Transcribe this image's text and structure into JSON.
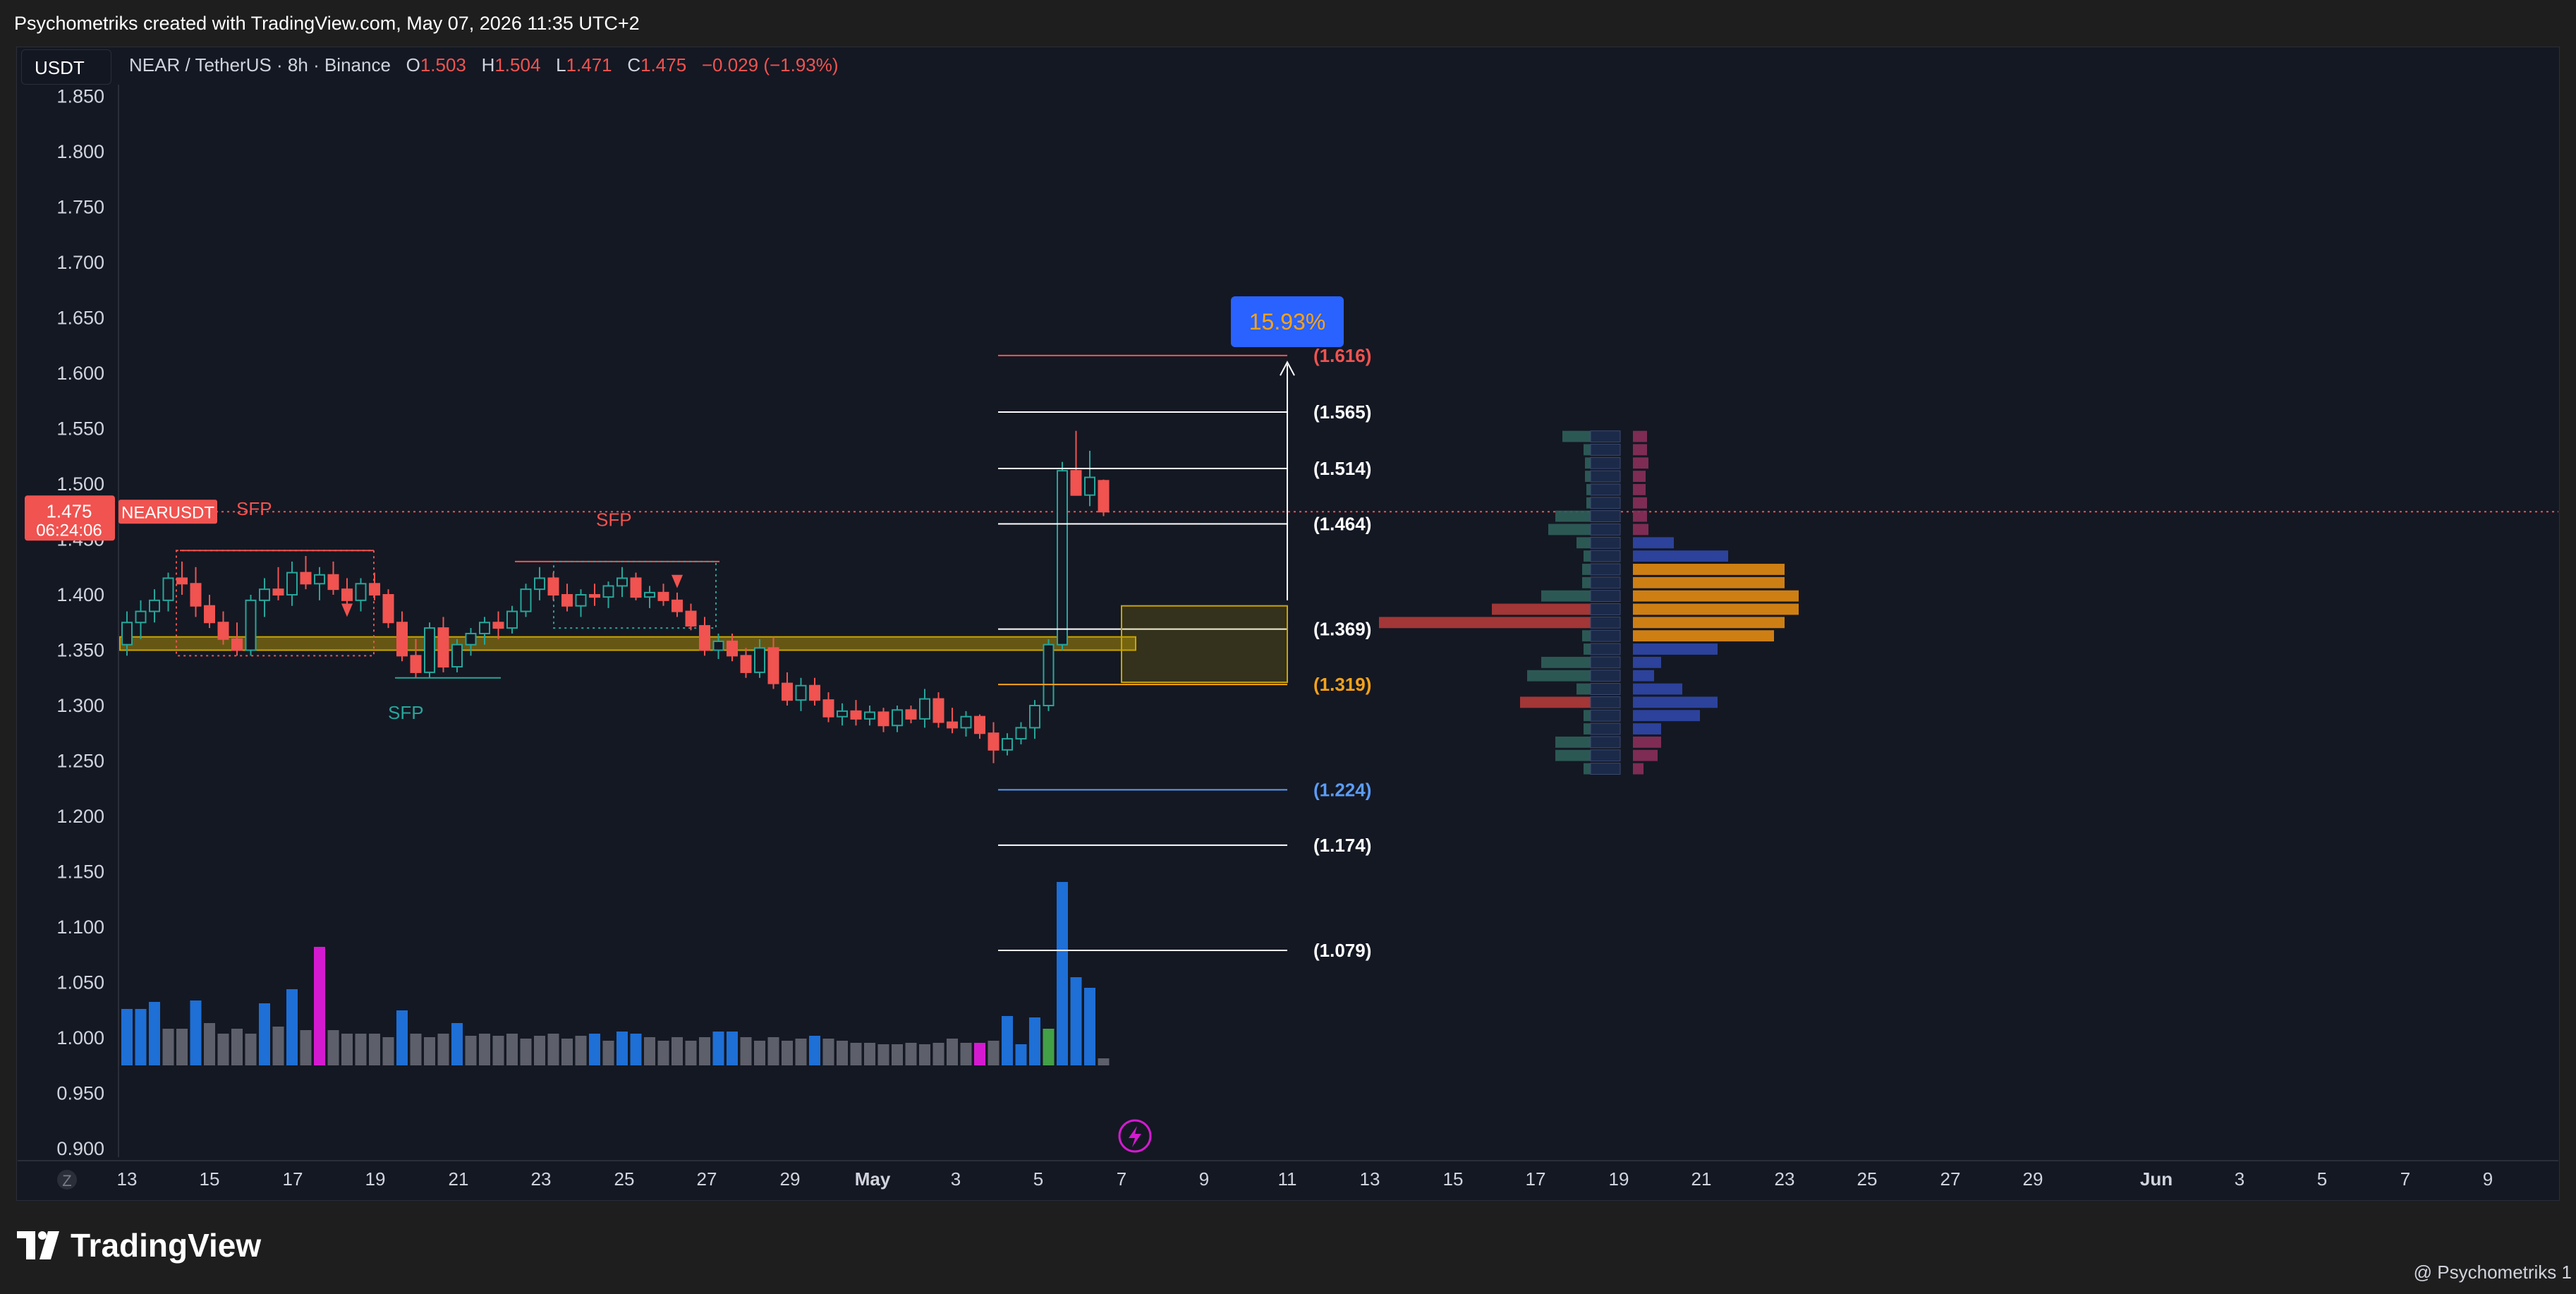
{
  "header": {
    "title": "Psychometriks created with TradingView.com, May 07, 2026 11:35 UTC+2"
  },
  "currency_button": {
    "label": "USDT"
  },
  "symbol_info": {
    "name": "NEAR / TetherUS · 8h · Binance",
    "o_label": "O",
    "o_value": "1.503",
    "h_label": "H",
    "h_value": "1.504",
    "l_label": "L",
    "l_value": "1.471",
    "c_label": "C",
    "c_value": "1.475",
    "change": "−0.029 (−1.93%)"
  },
  "price_label": {
    "value": "1.475",
    "countdown": "06:24:06",
    "symbol": "NEARUSDT"
  },
  "zoom_button": {
    "label": "Z"
  },
  "target_badge": {
    "label": "15.93%"
  },
  "branding": {
    "logo_text": "TradingView",
    "credit": "@ Psychometriks 1"
  },
  "colors": {
    "up": "#26a69a",
    "down": "#f05350",
    "accent": "#2962ff",
    "fib_orange": "#f7a21b",
    "fib_blue": "#5b9cf6",
    "volume_blue": "#1e6fd6",
    "volume_gray": "#5d606b",
    "volume_magenta": "#d41ad0",
    "volume_green": "#43a047",
    "zone": "#c8a400",
    "volume_profile_orange": "#e28b13"
  },
  "chart_data": {
    "type": "candlestick",
    "y_axis": {
      "ticks": [
        "1.850",
        "1.800",
        "1.750",
        "1.700",
        "1.650",
        "1.600",
        "1.550",
        "1.500",
        "1.450",
        "1.400",
        "1.350",
        "1.300",
        "1.250",
        "1.200",
        "1.150",
        "1.100",
        "1.050",
        "1.000",
        "0.950",
        "0.900"
      ]
    },
    "x_axis": {
      "ticks": [
        "13",
        "15",
        "17",
        "19",
        "21",
        "23",
        "25",
        "27",
        "29",
        "May",
        "3",
        "5",
        "7",
        "9",
        "11",
        "13",
        "15",
        "17",
        "19",
        "21",
        "23",
        "25",
        "27",
        "29",
        "Jun",
        "3",
        "5",
        "7",
        "9"
      ]
    },
    "fib_levels": [
      {
        "label": "(1.616)",
        "value": 1.616,
        "color": "down"
      },
      {
        "label": "(1.565)",
        "value": 1.565,
        "color": "white"
      },
      {
        "label": "(1.514)",
        "value": 1.514,
        "color": "white"
      },
      {
        "label": "(1.464)",
        "value": 1.464,
        "color": "white"
      },
      {
        "label": "(1.369)",
        "value": 1.369,
        "color": "white"
      },
      {
        "label": "(1.319)",
        "value": 1.319,
        "color": "fib_orange"
      },
      {
        "label": "(1.224)",
        "value": 1.224,
        "color": "fib_blue"
      },
      {
        "label": "(1.174)",
        "value": 1.174,
        "color": "white"
      },
      {
        "label": "(1.079)",
        "value": 1.079,
        "color": "white"
      }
    ],
    "annotations": [
      {
        "text": "SFP",
        "color": "down"
      },
      {
        "text": "SFP",
        "color": "down"
      },
      {
        "text": "SFP",
        "color": "up"
      }
    ],
    "candles": [
      [
        1.355,
        1.385,
        1.345,
        1.375
      ],
      [
        1.375,
        1.395,
        1.36,
        1.385
      ],
      [
        1.385,
        1.405,
        1.375,
        1.395
      ],
      [
        1.395,
        1.42,
        1.385,
        1.415
      ],
      [
        1.415,
        1.43,
        1.4,
        1.41
      ],
      [
        1.41,
        1.425,
        1.38,
        1.39
      ],
      [
        1.39,
        1.4,
        1.37,
        1.375
      ],
      [
        1.375,
        1.385,
        1.355,
        1.36
      ],
      [
        1.36,
        1.375,
        1.345,
        1.35
      ],
      [
        1.35,
        1.4,
        1.345,
        1.395
      ],
      [
        1.395,
        1.415,
        1.38,
        1.405
      ],
      [
        1.405,
        1.425,
        1.395,
        1.4
      ],
      [
        1.4,
        1.43,
        1.39,
        1.42
      ],
      [
        1.42,
        1.435,
        1.405,
        1.41
      ],
      [
        1.41,
        1.425,
        1.395,
        1.418
      ],
      [
        1.418,
        1.43,
        1.4,
        1.405
      ],
      [
        1.405,
        1.415,
        1.39,
        1.395
      ],
      [
        1.395,
        1.415,
        1.385,
        1.41
      ],
      [
        1.41,
        1.42,
        1.395,
        1.4
      ],
      [
        1.4,
        1.405,
        1.37,
        1.375
      ],
      [
        1.375,
        1.385,
        1.34,
        1.345
      ],
      [
        1.345,
        1.36,
        1.325,
        1.33
      ],
      [
        1.33,
        1.375,
        1.325,
        1.37
      ],
      [
        1.37,
        1.38,
        1.33,
        1.335
      ],
      [
        1.335,
        1.36,
        1.33,
        1.355
      ],
      [
        1.355,
        1.37,
        1.345,
        1.365
      ],
      [
        1.365,
        1.38,
        1.355,
        1.375
      ],
      [
        1.375,
        1.385,
        1.36,
        1.37
      ],
      [
        1.37,
        1.39,
        1.365,
        1.385
      ],
      [
        1.385,
        1.41,
        1.38,
        1.405
      ],
      [
        1.405,
        1.425,
        1.395,
        1.415
      ],
      [
        1.415,
        1.42,
        1.395,
        1.4
      ],
      [
        1.4,
        1.41,
        1.385,
        1.39
      ],
      [
        1.39,
        1.405,
        1.38,
        1.4
      ],
      [
        1.4,
        1.41,
        1.39,
        1.398
      ],
      [
        1.398,
        1.412,
        1.388,
        1.408
      ],
      [
        1.408,
        1.425,
        1.398,
        1.415
      ],
      [
        1.415,
        1.42,
        1.395,
        1.398
      ],
      [
        1.398,
        1.408,
        1.388,
        1.402
      ],
      [
        1.402,
        1.41,
        1.39,
        1.395
      ],
      [
        1.395,
        1.402,
        1.38,
        1.385
      ],
      [
        1.385,
        1.392,
        1.368,
        1.372
      ],
      [
        1.372,
        1.38,
        1.345,
        1.35
      ],
      [
        1.35,
        1.365,
        1.342,
        1.358
      ],
      [
        1.358,
        1.365,
        1.34,
        1.345
      ],
      [
        1.345,
        1.352,
        1.325,
        1.33
      ],
      [
        1.33,
        1.36,
        1.325,
        1.352
      ],
      [
        1.352,
        1.362,
        1.315,
        1.32
      ],
      [
        1.32,
        1.33,
        1.3,
        1.305
      ],
      [
        1.305,
        1.325,
        1.295,
        1.318
      ],
      [
        1.318,
        1.325,
        1.3,
        1.305
      ],
      [
        1.305,
        1.312,
        1.285,
        1.29
      ],
      [
        1.29,
        1.302,
        1.282,
        1.295
      ],
      [
        1.295,
        1.305,
        1.282,
        1.288
      ],
      [
        1.288,
        1.3,
        1.282,
        1.294
      ],
      [
        1.294,
        1.298,
        1.276,
        1.282
      ],
      [
        1.282,
        1.3,
        1.276,
        1.296
      ],
      [
        1.296,
        1.3,
        1.284,
        1.288
      ],
      [
        1.288,
        1.315,
        1.28,
        1.306
      ],
      [
        1.306,
        1.312,
        1.28,
        1.285
      ],
      [
        1.285,
        1.298,
        1.275,
        1.28
      ],
      [
        1.28,
        1.295,
        1.272,
        1.29
      ],
      [
        1.29,
        1.292,
        1.27,
        1.275
      ],
      [
        1.275,
        1.285,
        1.248,
        1.26
      ],
      [
        1.26,
        1.275,
        1.255,
        1.27
      ],
      [
        1.27,
        1.285,
        1.265,
        1.28
      ],
      [
        1.28,
        1.305,
        1.27,
        1.3
      ],
      [
        1.3,
        1.36,
        1.295,
        1.355
      ],
      [
        1.355,
        1.52,
        1.35,
        1.512
      ],
      [
        1.512,
        1.548,
        1.495,
        1.49
      ],
      [
        1.49,
        1.53,
        1.48,
        1.506
      ],
      [
        1.503,
        1.504,
        1.471,
        1.475
      ]
    ],
    "volume": [
      {
        "v": 1.0,
        "c": "volume_blue"
      },
      {
        "v": 1.0,
        "c": "volume_blue"
      },
      {
        "v": 1.0,
        "c": "volume_blue"
      },
      {
        "v": 1.0,
        "c": "volume_gray"
      },
      {
        "v": 1.0,
        "c": "volume_gray"
      },
      {
        "v": 1.0,
        "c": "volume_blue"
      },
      {
        "v": 1.0,
        "c": "volume_gray"
      },
      {
        "v": 1.0,
        "c": "volume_gray"
      },
      {
        "v": 1.0,
        "c": "volume_gray"
      },
      {
        "v": 1.0,
        "c": "volume_gray"
      },
      {
        "v": 1.0,
        "c": "volume_blue"
      },
      {
        "v": 1.0,
        "c": "volume_gray"
      },
      {
        "v": 1.0,
        "c": "volume_blue"
      },
      {
        "v": 1.0,
        "c": "volume_gray"
      },
      {
        "v": 1.0,
        "c": "volume_magenta"
      },
      {
        "v": 1.0,
        "c": "volume_gray"
      },
      {
        "v": 1.0,
        "c": "volume_gray"
      },
      {
        "v": 1.0,
        "c": "volume_gray"
      },
      {
        "v": 1.0,
        "c": "volume_gray"
      },
      {
        "v": 1.0,
        "c": "volume_gray"
      },
      {
        "v": 1.0,
        "c": "volume_blue"
      },
      {
        "v": 1.0,
        "c": "volume_gray"
      },
      {
        "v": 1.0,
        "c": "volume_gray"
      },
      {
        "v": 1.0,
        "c": "volume_gray"
      },
      {
        "v": 1.0,
        "c": "volume_blue"
      },
      {
        "v": 1.0,
        "c": "volume_gray"
      },
      {
        "v": 1.0,
        "c": "volume_gray"
      },
      {
        "v": 1.0,
        "c": "volume_gray"
      },
      {
        "v": 1.0,
        "c": "volume_gray"
      },
      {
        "v": 1.0,
        "c": "volume_gray"
      },
      {
        "v": 1.0,
        "c": "volume_gray"
      },
      {
        "v": 1.0,
        "c": "volume_gray"
      },
      {
        "v": 1.0,
        "c": "volume_gray"
      },
      {
        "v": 1.0,
        "c": "volume_gray"
      },
      {
        "v": 1.0,
        "c": "volume_blue"
      },
      {
        "v": 1.0,
        "c": "volume_gray"
      },
      {
        "v": 1.0,
        "c": "volume_blue"
      },
      {
        "v": 1.0,
        "c": "volume_blue"
      },
      {
        "v": 1.0,
        "c": "volume_gray"
      },
      {
        "v": 1.0,
        "c": "volume_gray"
      },
      {
        "v": 1.0,
        "c": "volume_gray"
      },
      {
        "v": 1.0,
        "c": "volume_gray"
      },
      {
        "v": 1.0,
        "c": "volume_gray"
      },
      {
        "v": 1.0,
        "c": "volume_blue"
      },
      {
        "v": 1.0,
        "c": "volume_blue"
      },
      {
        "v": 1.0,
        "c": "volume_gray"
      },
      {
        "v": 1.0,
        "c": "volume_gray"
      },
      {
        "v": 1.0,
        "c": "volume_gray"
      },
      {
        "v": 1.0,
        "c": "volume_gray"
      },
      {
        "v": 1.0,
        "c": "volume_gray"
      },
      {
        "v": 1.0,
        "c": "volume_blue"
      },
      {
        "v": 1.0,
        "c": "volume_gray"
      },
      {
        "v": 1.0,
        "c": "volume_gray"
      },
      {
        "v": 1.0,
        "c": "volume_gray"
      },
      {
        "v": 1.0,
        "c": "volume_gray"
      },
      {
        "v": 1.0,
        "c": "volume_gray"
      },
      {
        "v": 1.0,
        "c": "volume_gray"
      },
      {
        "v": 1.0,
        "c": "volume_gray"
      },
      {
        "v": 1.0,
        "c": "volume_gray"
      },
      {
        "v": 1.0,
        "c": "volume_gray"
      },
      {
        "v": 1.0,
        "c": "volume_gray"
      },
      {
        "v": 1.0,
        "c": "volume_gray"
      },
      {
        "v": 1.0,
        "c": "volume_magenta"
      },
      {
        "v": 1.0,
        "c": "volume_gray"
      },
      {
        "v": 1.0,
        "c": "volume_blue"
      },
      {
        "v": 1.0,
        "c": "volume_blue"
      },
      {
        "v": 1.0,
        "c": "volume_blue"
      },
      {
        "v": 1.0,
        "c": "volume_green"
      },
      {
        "v": 1.0,
        "c": "volume_blue"
      },
      {
        "v": 1.0,
        "c": "volume_blue"
      },
      {
        "v": 1.0,
        "c": "volume_blue"
      },
      {
        "v": 1.0,
        "c": "volume_gray"
      }
    ]
  }
}
